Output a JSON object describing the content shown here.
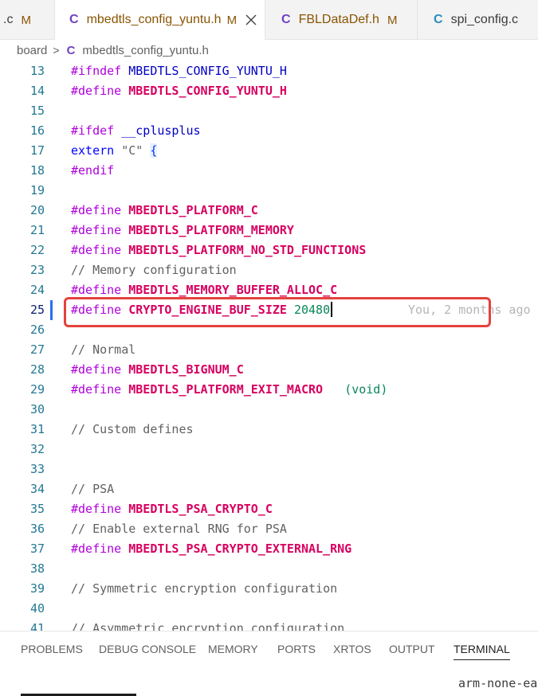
{
  "tabs": [
    {
      "label": ".c",
      "status": "M"
    },
    {
      "label": "mbedtls_config_yuntu.h",
      "status": "M",
      "icon": "c-file-icon",
      "active": true
    },
    {
      "label": "FBLDataDef.h",
      "status": "M",
      "icon": "c-file-icon"
    },
    {
      "label": "spi_config.c",
      "status": "",
      "icon": "c-file-icon"
    }
  ],
  "tab_icon_glyph": "C",
  "breadcrumb": {
    "folder": "board",
    "separator": ">",
    "file_icon": "C",
    "file": "mbedtls_config_yuntu.h"
  },
  "editor": {
    "lines": [
      {
        "n": "13",
        "parts": [
          [
            "#ifndef",
            "kw"
          ],
          [
            " ",
            "plain"
          ],
          [
            "MBEDTLS_CONFIG_YUNTU_H",
            "dir"
          ]
        ]
      },
      {
        "n": "14",
        "parts": [
          [
            "#define",
            "kw"
          ],
          [
            " ",
            "plain"
          ],
          [
            "MBEDTLS_CONFIG_YUNTU_H",
            "macro"
          ]
        ]
      },
      {
        "n": "15",
        "parts": []
      },
      {
        "n": "16",
        "parts": [
          [
            "#ifdef",
            "kw"
          ],
          [
            " ",
            "plain"
          ],
          [
            "__cplusplus",
            "dir"
          ]
        ]
      },
      {
        "n": "17",
        "parts": [
          [
            "extern",
            "extern"
          ],
          [
            " ",
            "plain"
          ],
          [
            "\"C\"",
            "comment"
          ],
          [
            " ",
            "plain"
          ],
          [
            "{",
            "brace"
          ]
        ]
      },
      {
        "n": "18",
        "parts": [
          [
            "#endif",
            "kw"
          ]
        ]
      },
      {
        "n": "19",
        "parts": []
      },
      {
        "n": "20",
        "parts": [
          [
            "#define",
            "kw"
          ],
          [
            " ",
            "plain"
          ],
          [
            "MBEDTLS_PLATFORM_C",
            "macro"
          ]
        ]
      },
      {
        "n": "21",
        "parts": [
          [
            "#define",
            "kw"
          ],
          [
            " ",
            "plain"
          ],
          [
            "MBEDTLS_PLATFORM_MEMORY",
            "macro"
          ]
        ]
      },
      {
        "n": "22",
        "parts": [
          [
            "#define",
            "kw"
          ],
          [
            " ",
            "plain"
          ],
          [
            "MBEDTLS_PLATFORM_NO_STD_FUNCTIONS",
            "macro"
          ]
        ]
      },
      {
        "n": "23",
        "parts": [
          [
            "// Memory configuration",
            "comment"
          ]
        ]
      },
      {
        "n": "24",
        "parts": [
          [
            "#define",
            "kw"
          ],
          [
            " ",
            "plain"
          ],
          [
            "MBEDTLS_MEMORY_BUFFER_ALLOC_C",
            "macro"
          ]
        ]
      },
      {
        "n": "25",
        "current": true,
        "parts": [
          [
            "#define",
            "kw"
          ],
          [
            " ",
            "plain"
          ],
          [
            "CRYPTO_ENGINE_BUF_SIZE",
            "macro"
          ],
          [
            " ",
            "plain"
          ],
          [
            "20480",
            "num"
          ]
        ],
        "blame": "You, 2 months ago"
      },
      {
        "n": "26",
        "parts": []
      },
      {
        "n": "27",
        "parts": [
          [
            "// Normal",
            "comment"
          ]
        ]
      },
      {
        "n": "28",
        "parts": [
          [
            "#define",
            "kw"
          ],
          [
            " ",
            "plain"
          ],
          [
            "MBEDTLS_BIGNUM_C",
            "macro"
          ]
        ]
      },
      {
        "n": "29",
        "parts": [
          [
            "#define",
            "kw"
          ],
          [
            " ",
            "plain"
          ],
          [
            "MBEDTLS_PLATFORM_EXIT_MACRO",
            "macro"
          ],
          [
            "   ",
            "plain"
          ],
          [
            "(void)",
            "void"
          ]
        ]
      },
      {
        "n": "30",
        "parts": []
      },
      {
        "n": "31",
        "parts": [
          [
            "// Custom defines",
            "comment"
          ]
        ]
      },
      {
        "n": "32",
        "parts": []
      },
      {
        "n": "33",
        "parts": []
      },
      {
        "n": "34",
        "parts": [
          [
            "// PSA",
            "comment"
          ]
        ]
      },
      {
        "n": "35",
        "parts": [
          [
            "#define",
            "kw"
          ],
          [
            " ",
            "plain"
          ],
          [
            "MBEDTLS_PSA_CRYPTO_C",
            "macro"
          ]
        ]
      },
      {
        "n": "36",
        "parts": [
          [
            "// Enable external RNG for PSA",
            "comment"
          ]
        ]
      },
      {
        "n": "37",
        "parts": [
          [
            "#define",
            "kw"
          ],
          [
            " ",
            "plain"
          ],
          [
            "MBEDTLS_PSA_CRYPTO_EXTERNAL_RNG",
            "macro"
          ]
        ]
      },
      {
        "n": "38",
        "parts": []
      },
      {
        "n": "39",
        "parts": [
          [
            "// Symmetric encryption configuration",
            "comment"
          ]
        ]
      },
      {
        "n": "40",
        "parts": []
      },
      {
        "n": "41",
        "parts": [
          [
            "// Asymmetric encryption configuration",
            "comment"
          ]
        ]
      }
    ]
  },
  "panel": {
    "tabs": [
      "PROBLEMS",
      "DEBUG CONSOLE",
      "MEMORY",
      "PORTS",
      "XRTOS",
      "OUTPUT",
      "TERMINAL"
    ],
    "active": "TERMINAL",
    "terminal_text": "arm-none-ea"
  },
  "colors": {
    "highlight_box": "#e5423d",
    "keyword": "#af00db",
    "macro": "#d70060",
    "number": "#098658",
    "comment": "#616161",
    "line_number": "#237893",
    "modified_marker": "#2a6df4"
  }
}
